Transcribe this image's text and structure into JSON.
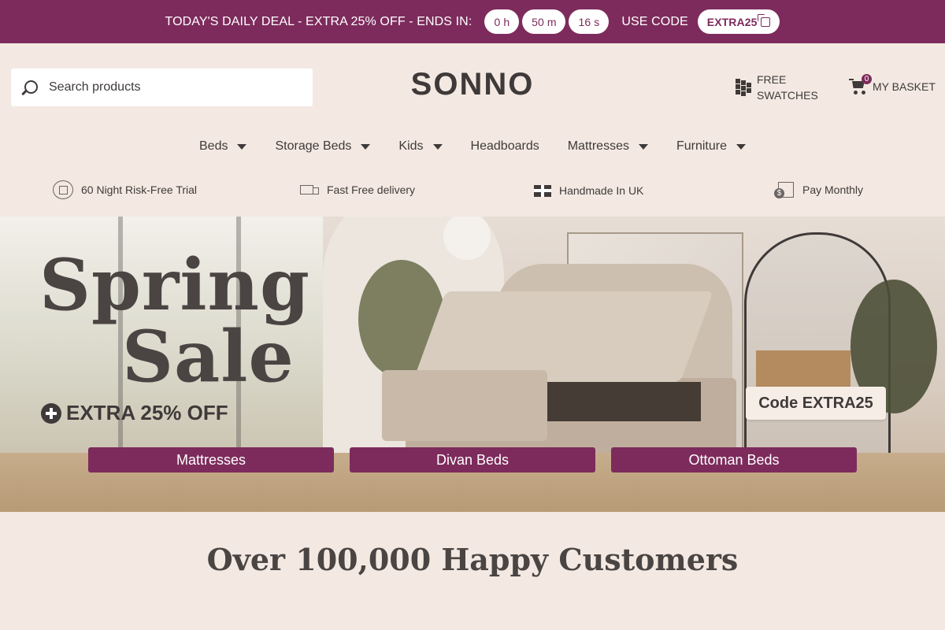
{
  "colors": {
    "brand": "#7d2b5c",
    "background": "#f3e9e2",
    "text": "#3f3a39"
  },
  "promo_bar": {
    "deal_text": "TODAY'S DAILY DEAL - EXTRA 25% OFF - ENDS IN:",
    "countdown": {
      "hours": "0 h",
      "minutes": "50 m",
      "seconds": "16 s"
    },
    "use_code_text": "USE CODE",
    "code": "EXTRA25"
  },
  "header": {
    "search_placeholder": "Search products",
    "logo": "SONNO",
    "swatches_label": "FREE SWATCHES",
    "basket_label": "MY BASKET",
    "basket_count": "0"
  },
  "nav": [
    {
      "label": "Beds",
      "has_dropdown": true
    },
    {
      "label": "Storage Beds",
      "has_dropdown": true
    },
    {
      "label": "Kids",
      "has_dropdown": true
    },
    {
      "label": "Headboards",
      "has_dropdown": false
    },
    {
      "label": "Mattresses",
      "has_dropdown": true
    },
    {
      "label": "Furniture",
      "has_dropdown": true
    }
  ],
  "usps": [
    {
      "label": "60 Night Risk-Free Trial",
      "icon": "trial-icon"
    },
    {
      "label": "Fast Free delivery",
      "icon": "truck-icon"
    },
    {
      "label": "Handmade In UK",
      "icon": "uk-flag-icon"
    },
    {
      "label": "Pay Monthly",
      "icon": "calendar-pay-icon"
    }
  ],
  "hero": {
    "title_line1": "Spring",
    "title_line2": "Sale",
    "offer": "EXTRA 25% OFF",
    "code_text": "Code EXTRA25",
    "buttons": [
      "Mattresses",
      "Divan Beds",
      "Ottoman Beds"
    ]
  },
  "section": {
    "headline": "Over 100,000 Happy Customers"
  }
}
